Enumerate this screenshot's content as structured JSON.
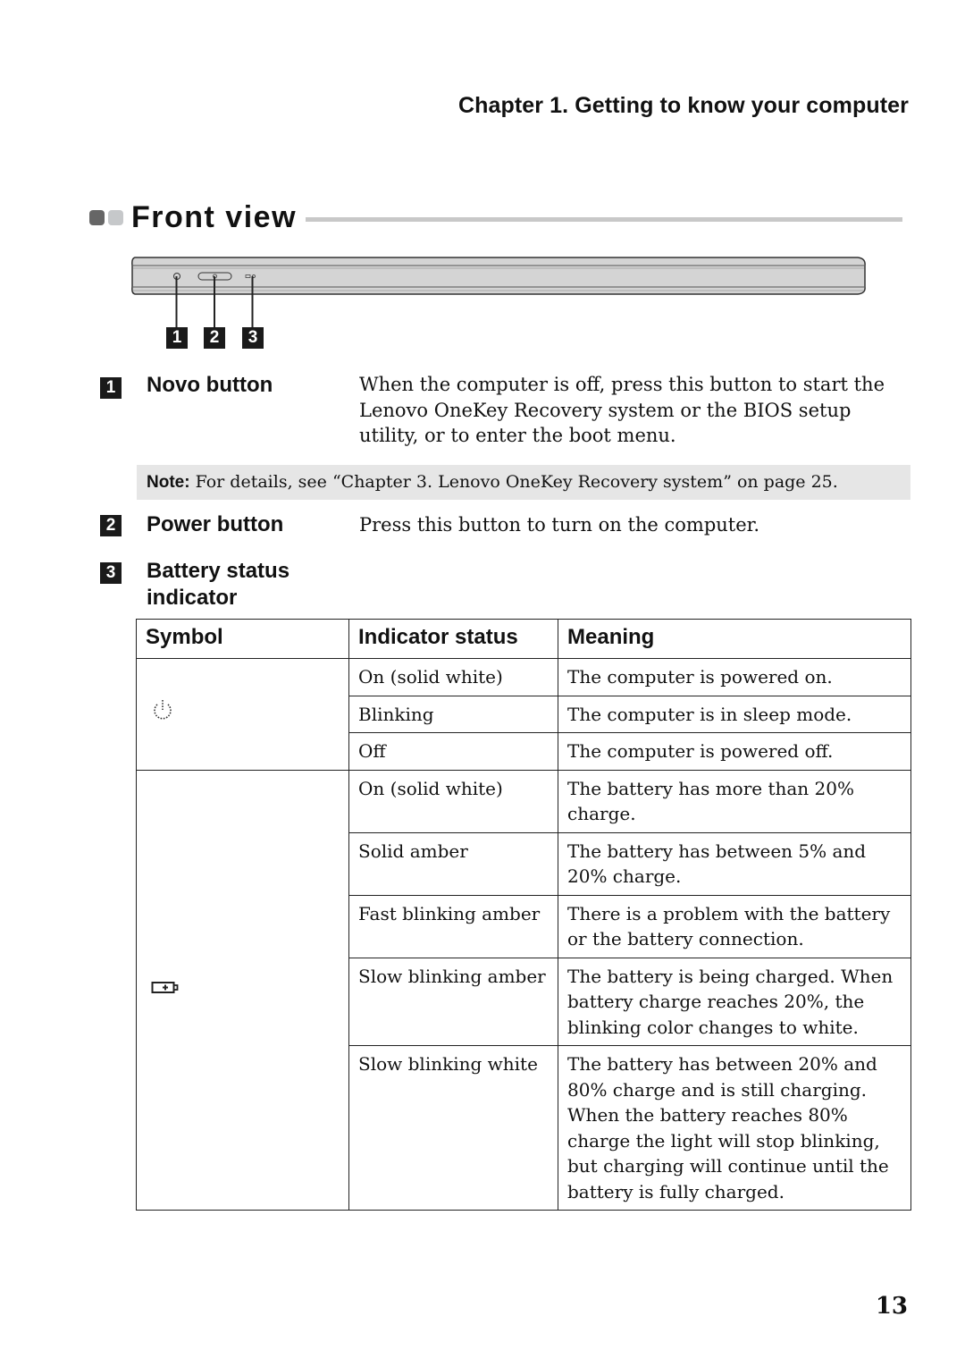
{
  "chapter_header": "Chapter 1. Getting to know your computer",
  "section_title": "Front view",
  "callouts": [
    "1",
    "2",
    "3"
  ],
  "items": [
    {
      "number": "1",
      "label": "Novo button",
      "description": "When the computer is off, press this button to start the Lenovo OneKey Recovery system or the BIOS setup utility, or to enter the boot menu."
    },
    {
      "number": "2",
      "label": "Power button",
      "description": "Press this button to turn on the computer."
    },
    {
      "number": "3",
      "label": "Battery status indicator",
      "description": ""
    }
  ],
  "note": {
    "label": "Note:",
    "text": " For details, see “Chapter 3. Lenovo OneKey Recovery system” on page 25."
  },
  "table": {
    "headers": [
      "Symbol",
      "Indicator status",
      "Meaning"
    ],
    "groups": [
      {
        "symbol_icon": "power-icon",
        "rows": [
          {
            "status": "On (solid white)",
            "meaning": "The computer is powered on."
          },
          {
            "status": "Blinking",
            "meaning": "The computer is in sleep mode."
          },
          {
            "status": "Off",
            "meaning": "The computer is powered off."
          }
        ]
      },
      {
        "symbol_icon": "battery-icon",
        "rows": [
          {
            "status": "On (solid white)",
            "meaning": "The battery has more than 20% charge."
          },
          {
            "status": "Solid amber",
            "meaning": "The battery has between 5% and 20% charge."
          },
          {
            "status": "Fast blinking amber",
            "meaning": "There is a problem with the battery or the battery connection."
          },
          {
            "status": "Slow blinking amber",
            "meaning": "The battery is being charged. When battery charge reaches 20%, the blinking color changes to white."
          },
          {
            "status": "Slow blinking white",
            "meaning": "The battery has between 20% and 80% charge and is still charging. When the battery reaches 80% charge the light will stop blinking, but charging will continue until the battery is fully charged."
          }
        ]
      }
    ]
  },
  "page_number": "13"
}
